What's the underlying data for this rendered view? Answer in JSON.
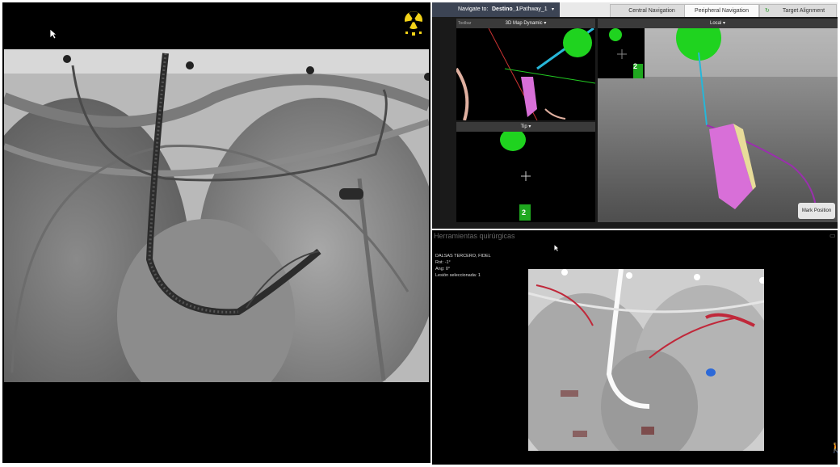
{
  "nav": {
    "navigate_to_label": "Navigate to:",
    "destination": "Destino_1",
    "pathway": "Pathway_1",
    "tabs": [
      "Central Navigation",
      "Peripheral Navigation",
      "Target Alignment"
    ],
    "active_tab": "Peripheral Navigation"
  },
  "panes": {
    "map3d_label": "3D Map Dynamic",
    "toolbar_label": "Toolbar",
    "tip_label": "Tip",
    "local_label": "Local",
    "target_distance": "2",
    "mark_position_label": "Mark Position"
  },
  "tools": {
    "title": "Herramientas quirúrgicas",
    "patient_name": "DALSAS TERCERO, FIDEL",
    "rot_line": "Rot: -1°",
    "ang_line": "Ang: 0°",
    "lesion_line": "Lesión seleccionada: 1"
  },
  "colors": {
    "green_target": "#1fd31f",
    "catheter_magenta": "#d86fd8",
    "path_cyan": "#27b6d8",
    "path_purple": "#9b2fae",
    "radiation_yellow": "#f2d218"
  }
}
